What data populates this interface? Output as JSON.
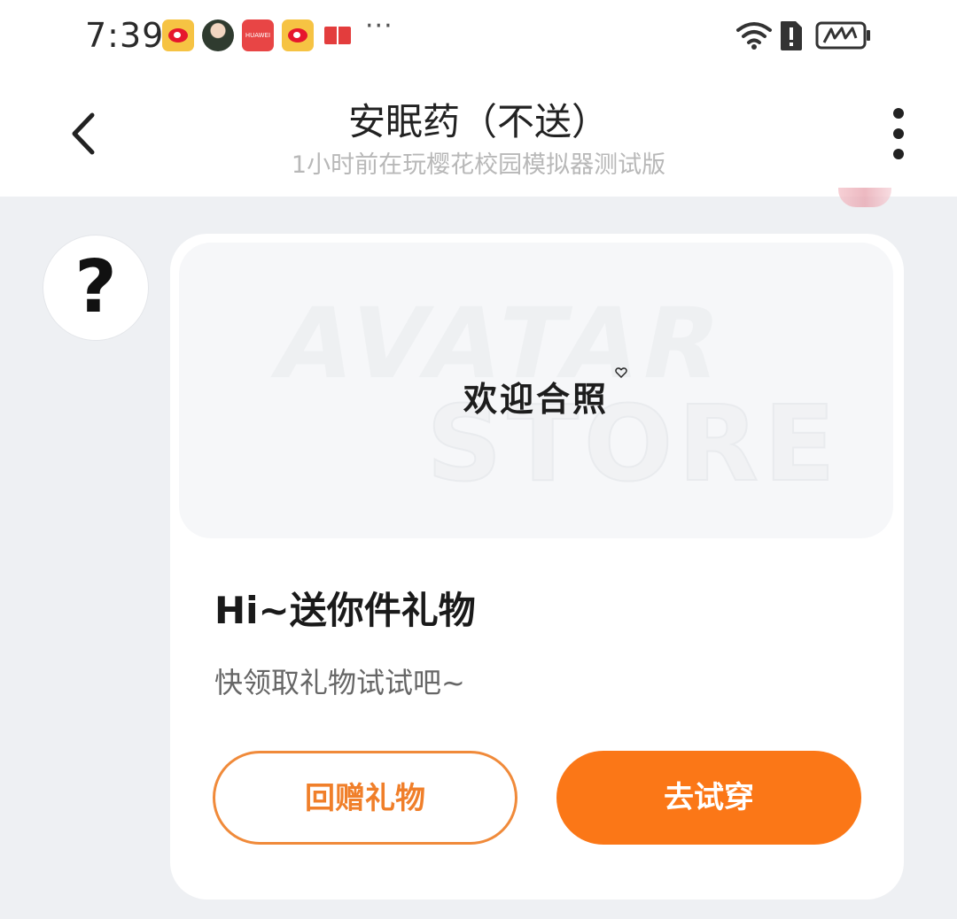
{
  "status_bar": {
    "time": "7:39",
    "more_indicator": "···",
    "huawei_label": "HUAWEI",
    "icons": [
      "weibo-icon",
      "avatar-notification-icon",
      "huawei-appgallery-icon",
      "weibo-icon",
      "book-icon",
      "wifi-icon",
      "sim-alert-icon",
      "battery-charging-icon"
    ]
  },
  "header": {
    "title": "安眠药（不送）",
    "subtitle": "1小时前在玩樱花校园模拟器测试版"
  },
  "sender_avatar": {
    "glyph": "?"
  },
  "gift_card": {
    "banner_watermark_line1": "AVATAR",
    "banner_watermark_line2": "STORE",
    "banner_caption": "欢迎合照",
    "title": "Hi~送你件礼物",
    "subtitle": "快领取礼物试试吧~",
    "return_gift_label": "回赠礼物",
    "try_on_label": "去试穿"
  },
  "colors": {
    "accent_orange": "#fb7717",
    "outline_orange": "#f08a3a",
    "page_background": "#eef0f3"
  }
}
